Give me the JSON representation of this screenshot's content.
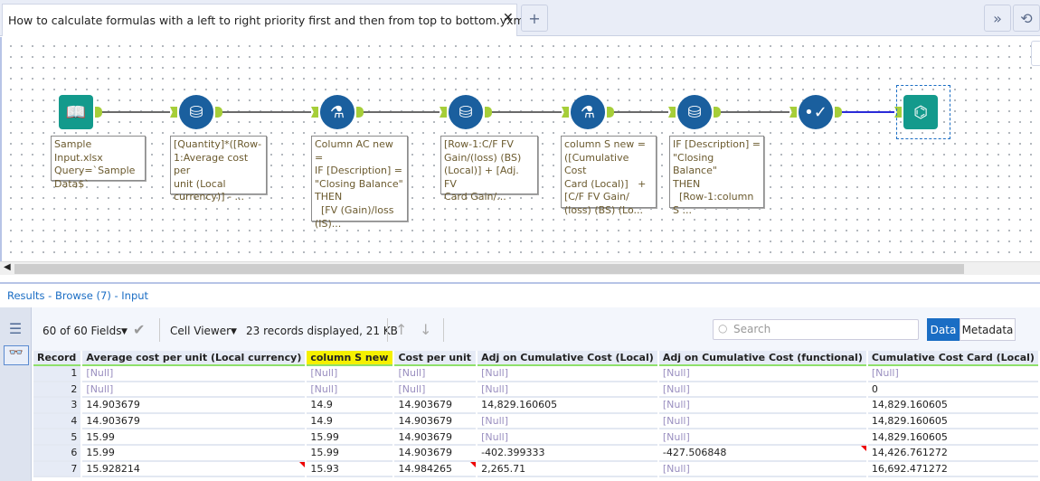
{
  "tab": {
    "title": "How to calculate formulas with a left to right priority first and then from top to bottom.yxmd",
    "close": "✕",
    "new_tab": "+"
  },
  "header_buttons": {
    "expand": "»",
    "history": "⟲"
  },
  "workflow": {
    "tools": [
      {
        "name": "input",
        "icon": "book-icon",
        "note": "Sample Input.xlsx\nQuery=`Sample\nData$`"
      },
      {
        "name": "formula-1",
        "icon": "formula-icon",
        "note": "[Quantity]*([Row-\n1:Average cost per\nunit (Local\ncurrency)] - ..."
      },
      {
        "name": "multi-row-1",
        "icon": "flask-icon",
        "note": "Column AC new =\nIF [Description] =\n\"Closing Balance\"\nTHEN\n  [FV (Gain)/loss\n(IS)..."
      },
      {
        "name": "formula-2",
        "icon": "formula-icon",
        "note": "[Row-1:C/F FV\nGain/(loss) (BS)\n(Local)] + [Adj. FV\nCard Gain/..."
      },
      {
        "name": "multi-row-2",
        "icon": "flask-icon",
        "note": "column S new =\n([Cumulative Cost\nCard (Local)]   +\n[C/F FV Gain/\n(loss) (BS) (Lo..."
      },
      {
        "name": "formula-3",
        "icon": "formula-icon",
        "note": "IF [Description] =\n\"Closing Balance\"\nTHEN\n  [Row-1:column\nS ..."
      },
      {
        "name": "select",
        "icon": "check-icon",
        "note": ""
      },
      {
        "name": "browse",
        "icon": "binoculars-icon",
        "note": ""
      }
    ]
  },
  "results": {
    "title": "Results - Browse (7) - Input",
    "fields": "60 of 60 Fields",
    "cell_viewer": "Cell Viewer",
    "summary": "23 records displayed, 21 KB",
    "search_placeholder": "Search",
    "data_btn": "Data",
    "metadata_btn": "Metadata",
    "columns": [
      "Record",
      "Average cost per unit (Local currency)",
      "column S new",
      "Cost per unit",
      "Adj on Cumulative Cost (Local)",
      "Adj on Cumulative Cost (functional)",
      "Cumulative Cost Card (Local)"
    ],
    "rows": [
      [
        "1",
        "[Null]",
        "[Null]",
        "[Null]",
        "[Null]",
        "[Null]",
        "[Null]"
      ],
      [
        "2",
        "[Null]",
        "[Null]",
        "[Null]",
        "[Null]",
        "[Null]",
        "0"
      ],
      [
        "3",
        "14.903679",
        "14.9",
        "14.903679",
        "14,829.160605",
        "[Null]",
        "14,829.160605"
      ],
      [
        "4",
        "14.903679",
        "14.9",
        "14.903679",
        "[Null]",
        "[Null]",
        "14,829.160605"
      ],
      [
        "5",
        "15.99",
        "15.99",
        "14.903679",
        "[Null]",
        "[Null]",
        "14,829.160605"
      ],
      [
        "6",
        "15.99",
        "15.99",
        "14.903679",
        "-402.399333",
        "-427.506848",
        "14,426.761272"
      ],
      [
        "7",
        "15.928214",
        "15.93",
        "14.984265",
        "2,265.71",
        "[Null]",
        "16,692.471272"
      ]
    ]
  }
}
